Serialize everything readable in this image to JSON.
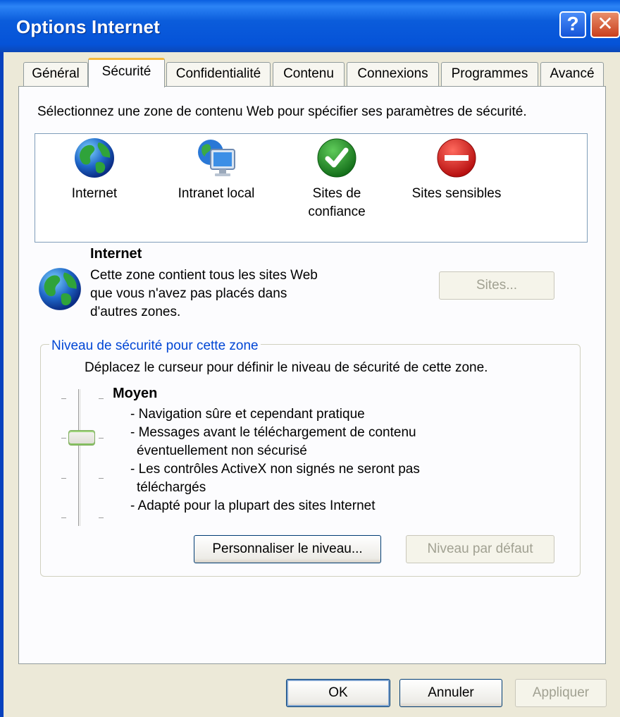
{
  "window": {
    "title": "Options Internet",
    "help_glyph": "?",
    "close_glyph": "✕"
  },
  "tabs": [
    {
      "label": "Général"
    },
    {
      "label": "Sécurité"
    },
    {
      "label": "Confidentialité"
    },
    {
      "label": "Contenu"
    },
    {
      "label": "Connexions"
    },
    {
      "label": "Programmes"
    },
    {
      "label": "Avancé"
    }
  ],
  "security": {
    "instruction": "Sélectionnez une zone de contenu Web pour spécifier ses paramètres de sécurité.",
    "zones": [
      {
        "label": "Internet",
        "icon": "globe-icon"
      },
      {
        "label": "Intranet local",
        "icon": "intranet-icon"
      },
      {
        "label": "Sites de confiance",
        "icon": "trusted-check-icon"
      },
      {
        "label": "Sites sensibles",
        "icon": "restricted-icon"
      }
    ],
    "selected_zone": {
      "title": "Internet",
      "description": "Cette zone contient tous les sites Web que vous n'avez pas placés dans d'autres zones."
    },
    "sites_button": "Sites...",
    "level_group": {
      "legend": "Niveau de sécurité pour cette zone",
      "hint": "Déplacez le curseur pour définir le niveau de sécurité de cette zone.",
      "level": "Moyen",
      "slider_position": "2 of 4",
      "items": [
        "- Navigation sûre et cependant pratique",
        "- Messages avant le téléchargement de contenu éventuellement non sécurisé",
        "- Les contrôles ActiveX non signés ne seront pas téléchargés",
        "- Adapté pour la plupart des sites Internet"
      ],
      "custom_button": "Personnaliser le niveau...",
      "default_button": "Niveau par défaut"
    }
  },
  "footer": {
    "ok": "OK",
    "cancel": "Annuler",
    "apply": "Appliquer"
  },
  "colors": {
    "title_bar": "#0553D8",
    "accent_tab": "#F4B83C",
    "legend_text": "#0046D5"
  }
}
